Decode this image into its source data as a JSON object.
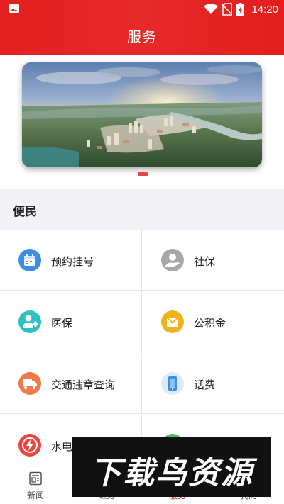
{
  "status_bar": {
    "time": "14:20"
  },
  "header": {
    "title": "服务"
  },
  "banner": {
    "slide_count": 1,
    "active_slide": 1
  },
  "section": {
    "title": "便民"
  },
  "services": [
    {
      "label": "预约挂号",
      "icon": "calendar-icon",
      "color": "#3a8ee6"
    },
    {
      "label": "社保",
      "icon": "social-security-icon",
      "color": "#9a9a9a"
    },
    {
      "label": "医保",
      "icon": "medical-insurance-icon",
      "color": "#2fc1bf"
    },
    {
      "label": "公积金",
      "icon": "provident-fund-icon",
      "color": "#f2b31a"
    },
    {
      "label": "交通违章查询",
      "icon": "truck-icon",
      "color": "#f07a4a"
    },
    {
      "label": "话费",
      "icon": "phone-bill-icon",
      "color": "#3a8ee6"
    },
    {
      "label": "水电",
      "icon": "utility-icon",
      "color": "#e9463f"
    },
    {
      "label": "",
      "icon": "green-service-icon",
      "color": "#4cbf5a"
    }
  ],
  "tabbar": {
    "items": [
      {
        "label": "新闻",
        "icon": "news-icon"
      },
      {
        "label": "政务",
        "icon": "government-icon"
      },
      {
        "label": "服务",
        "icon": "service-icon"
      },
      {
        "label": "我的",
        "icon": "profile-icon"
      }
    ],
    "active_index": 2
  },
  "watermark": {
    "text": "下载鸟资源"
  },
  "colors": {
    "accent": "#e3201f",
    "section_bg": "#f3f3f7",
    "divider": "#e4e4e4"
  }
}
